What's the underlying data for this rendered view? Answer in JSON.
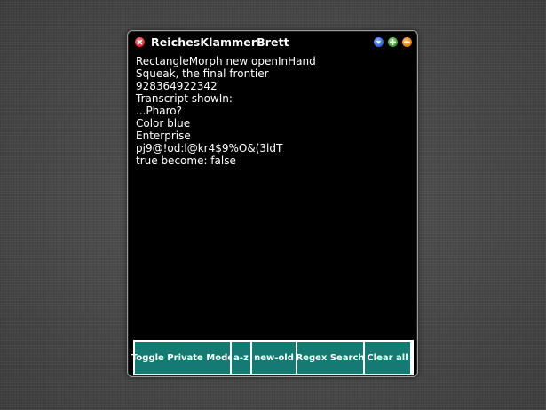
{
  "window": {
    "title": "ReichesKlammerBrett",
    "controls": {
      "close_icon": "close-icon",
      "menu_icon": "menu-icon",
      "expand_icon": "expand-icon",
      "collapse_icon": "collapse-icon"
    }
  },
  "clipboard_items": [
    "RectangleMorph new openInHand",
    "Squeak, the final frontier",
    "928364922342",
    "Transcript showIn:",
    "...Pharo?",
    "Color blue",
    "Enterprise",
    "pj9@!od:l@kr4$9%O&(3ldT",
    "true become: false"
  ],
  "toolbar": {
    "toggle_private_label": "Toggle Private Mode",
    "sort_az_label": "a-z",
    "sort_newold_label": "new-old",
    "regex_search_label": "Regex Search",
    "clear_all_label": "Clear all"
  },
  "colors": {
    "window_background": "#000000",
    "toolbar_button": "#157a72",
    "text": "#ffffff",
    "desktop": "#4a4a4a"
  }
}
